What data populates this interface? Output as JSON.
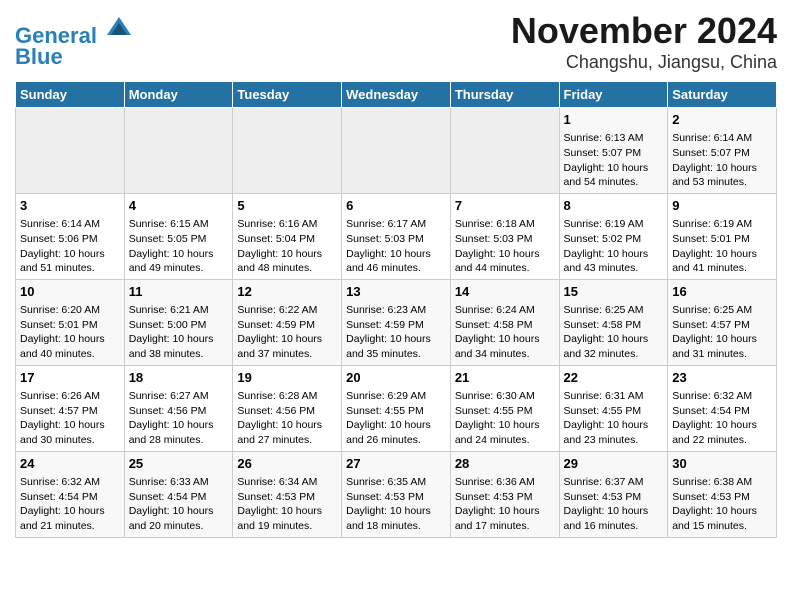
{
  "header": {
    "logo_line1": "General",
    "logo_line2": "Blue",
    "title": "November 2024",
    "subtitle": "Changshu, Jiangsu, China"
  },
  "weekdays": [
    "Sunday",
    "Monday",
    "Tuesday",
    "Wednesday",
    "Thursday",
    "Friday",
    "Saturday"
  ],
  "weeks": [
    [
      {
        "day": "",
        "info": ""
      },
      {
        "day": "",
        "info": ""
      },
      {
        "day": "",
        "info": ""
      },
      {
        "day": "",
        "info": ""
      },
      {
        "day": "",
        "info": ""
      },
      {
        "day": "1",
        "info": "Sunrise: 6:13 AM\nSunset: 5:07 PM\nDaylight: 10 hours and 54 minutes."
      },
      {
        "day": "2",
        "info": "Sunrise: 6:14 AM\nSunset: 5:07 PM\nDaylight: 10 hours and 53 minutes."
      }
    ],
    [
      {
        "day": "3",
        "info": "Sunrise: 6:14 AM\nSunset: 5:06 PM\nDaylight: 10 hours and 51 minutes."
      },
      {
        "day": "4",
        "info": "Sunrise: 6:15 AM\nSunset: 5:05 PM\nDaylight: 10 hours and 49 minutes."
      },
      {
        "day": "5",
        "info": "Sunrise: 6:16 AM\nSunset: 5:04 PM\nDaylight: 10 hours and 48 minutes."
      },
      {
        "day": "6",
        "info": "Sunrise: 6:17 AM\nSunset: 5:03 PM\nDaylight: 10 hours and 46 minutes."
      },
      {
        "day": "7",
        "info": "Sunrise: 6:18 AM\nSunset: 5:03 PM\nDaylight: 10 hours and 44 minutes."
      },
      {
        "day": "8",
        "info": "Sunrise: 6:19 AM\nSunset: 5:02 PM\nDaylight: 10 hours and 43 minutes."
      },
      {
        "day": "9",
        "info": "Sunrise: 6:19 AM\nSunset: 5:01 PM\nDaylight: 10 hours and 41 minutes."
      }
    ],
    [
      {
        "day": "10",
        "info": "Sunrise: 6:20 AM\nSunset: 5:01 PM\nDaylight: 10 hours and 40 minutes."
      },
      {
        "day": "11",
        "info": "Sunrise: 6:21 AM\nSunset: 5:00 PM\nDaylight: 10 hours and 38 minutes."
      },
      {
        "day": "12",
        "info": "Sunrise: 6:22 AM\nSunset: 4:59 PM\nDaylight: 10 hours and 37 minutes."
      },
      {
        "day": "13",
        "info": "Sunrise: 6:23 AM\nSunset: 4:59 PM\nDaylight: 10 hours and 35 minutes."
      },
      {
        "day": "14",
        "info": "Sunrise: 6:24 AM\nSunset: 4:58 PM\nDaylight: 10 hours and 34 minutes."
      },
      {
        "day": "15",
        "info": "Sunrise: 6:25 AM\nSunset: 4:58 PM\nDaylight: 10 hours and 32 minutes."
      },
      {
        "day": "16",
        "info": "Sunrise: 6:25 AM\nSunset: 4:57 PM\nDaylight: 10 hours and 31 minutes."
      }
    ],
    [
      {
        "day": "17",
        "info": "Sunrise: 6:26 AM\nSunset: 4:57 PM\nDaylight: 10 hours and 30 minutes."
      },
      {
        "day": "18",
        "info": "Sunrise: 6:27 AM\nSunset: 4:56 PM\nDaylight: 10 hours and 28 minutes."
      },
      {
        "day": "19",
        "info": "Sunrise: 6:28 AM\nSunset: 4:56 PM\nDaylight: 10 hours and 27 minutes."
      },
      {
        "day": "20",
        "info": "Sunrise: 6:29 AM\nSunset: 4:55 PM\nDaylight: 10 hours and 26 minutes."
      },
      {
        "day": "21",
        "info": "Sunrise: 6:30 AM\nSunset: 4:55 PM\nDaylight: 10 hours and 24 minutes."
      },
      {
        "day": "22",
        "info": "Sunrise: 6:31 AM\nSunset: 4:55 PM\nDaylight: 10 hours and 23 minutes."
      },
      {
        "day": "23",
        "info": "Sunrise: 6:32 AM\nSunset: 4:54 PM\nDaylight: 10 hours and 22 minutes."
      }
    ],
    [
      {
        "day": "24",
        "info": "Sunrise: 6:32 AM\nSunset: 4:54 PM\nDaylight: 10 hours and 21 minutes."
      },
      {
        "day": "25",
        "info": "Sunrise: 6:33 AM\nSunset: 4:54 PM\nDaylight: 10 hours and 20 minutes."
      },
      {
        "day": "26",
        "info": "Sunrise: 6:34 AM\nSunset: 4:53 PM\nDaylight: 10 hours and 19 minutes."
      },
      {
        "day": "27",
        "info": "Sunrise: 6:35 AM\nSunset: 4:53 PM\nDaylight: 10 hours and 18 minutes."
      },
      {
        "day": "28",
        "info": "Sunrise: 6:36 AM\nSunset: 4:53 PM\nDaylight: 10 hours and 17 minutes."
      },
      {
        "day": "29",
        "info": "Sunrise: 6:37 AM\nSunset: 4:53 PM\nDaylight: 10 hours and 16 minutes."
      },
      {
        "day": "30",
        "info": "Sunrise: 6:38 AM\nSunset: 4:53 PM\nDaylight: 10 hours and 15 minutes."
      }
    ]
  ]
}
